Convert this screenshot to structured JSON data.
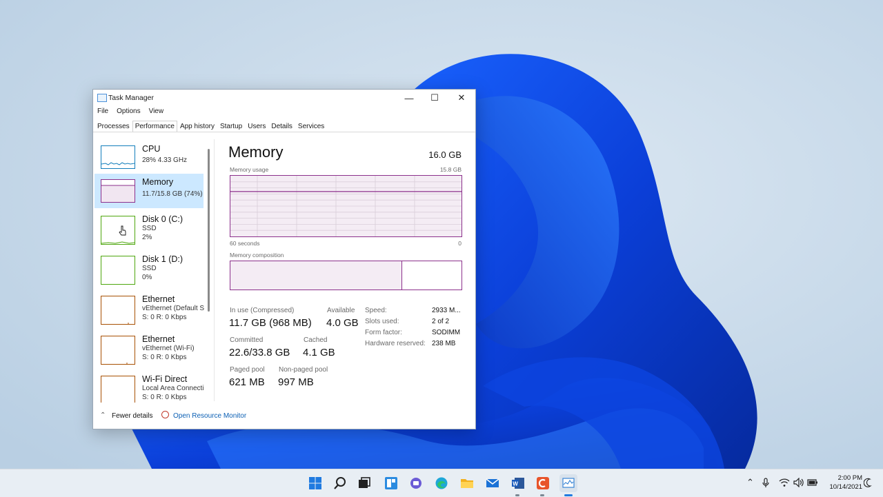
{
  "window": {
    "title": "Task Manager",
    "menu": [
      "File",
      "Options",
      "View"
    ],
    "tabs": [
      "Processes",
      "Performance",
      "App history",
      "Startup",
      "Users",
      "Details",
      "Services"
    ],
    "active_tab": "Performance"
  },
  "sidebar": [
    {
      "name": "CPU",
      "line1": "28%  4.33 GHz",
      "line2": ""
    },
    {
      "name": "Memory",
      "line1": "11.7/15.8 GB (74%)",
      "line2": ""
    },
    {
      "name": "Disk 0 (C:)",
      "line1": "SSD",
      "line2": "2%"
    },
    {
      "name": "Disk 1 (D:)",
      "line1": "SSD",
      "line2": "0%"
    },
    {
      "name": "Ethernet",
      "line1": "vEthernet (Default S...",
      "line2": "S: 0  R: 0 Kbps"
    },
    {
      "name": "Ethernet",
      "line1": "vEthernet (Wi-Fi)",
      "line2": "S: 0  R: 0 Kbps"
    },
    {
      "name": "Wi-Fi Direct",
      "line1": "Local Area Connecti...",
      "line2": "S: 0  R: 0 Kbps"
    }
  ],
  "memory": {
    "title": "Memory",
    "total": "16.0 GB",
    "usage_label": "Memory usage",
    "usage_max": "15.8 GB",
    "axis_left": "60 seconds",
    "axis_right": "0",
    "composition_label": "Memory composition",
    "usage_fraction": 0.74,
    "stats": {
      "in_use_label": "In use (Compressed)",
      "in_use": "11.7 GB (968 MB)",
      "available_label": "Available",
      "available": "4.0 GB",
      "committed_label": "Committed",
      "committed": "22.6/33.8 GB",
      "cached_label": "Cached",
      "cached": "4.1 GB",
      "paged_label": "Paged pool",
      "paged": "621 MB",
      "nonpaged_label": "Non-paged pool",
      "nonpaged": "997 MB"
    },
    "details": [
      {
        "label": "Speed:",
        "value": "2933 M..."
      },
      {
        "label": "Slots used:",
        "value": "2 of 2"
      },
      {
        "label": "Form factor:",
        "value": "SODIMM"
      },
      {
        "label": "Hardware reserved:",
        "value": "238 MB"
      }
    ]
  },
  "footer": {
    "fewer": "Fewer details",
    "resmon": "Open Resource Monitor"
  },
  "taskbar": {
    "time": "2:00 PM",
    "date": "10/14/2021",
    "icons": [
      "windows-start-icon",
      "search-icon",
      "task-view-icon",
      "widgets-icon",
      "teams-chat-icon",
      "edge-icon",
      "file-explorer-icon",
      "mail-icon",
      "word-icon",
      "camtasia-icon",
      "task-manager-icon"
    ]
  },
  "colors": {
    "accent_memory": "#8b2f8b",
    "selection": "#cce8ff",
    "link": "#0a5fb4"
  }
}
